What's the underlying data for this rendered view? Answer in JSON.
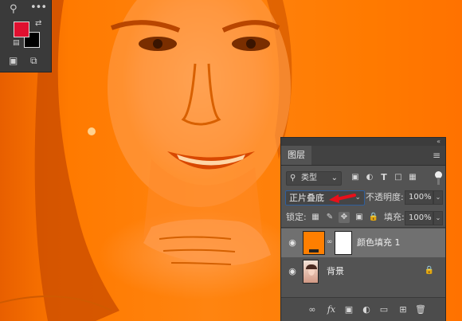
{
  "panel": {
    "tab_label": "图层",
    "filter_kind": "类型",
    "blend_mode": "正片叠底",
    "opacity_label": "不透明度:",
    "opacity_value": "100%",
    "lock_label": "锁定:",
    "fill_label": "填充:",
    "fill_value": "100%",
    "layers": [
      {
        "name": "颜色填充 1",
        "selected": true,
        "fill_color": "#ff7f00"
      },
      {
        "name": "背景",
        "selected": false,
        "locked": true
      }
    ]
  },
  "tools": {
    "foreground_color": "#e01030",
    "background_color": "#000000"
  },
  "canvas": {
    "overlay_color": "#ff7a00"
  }
}
